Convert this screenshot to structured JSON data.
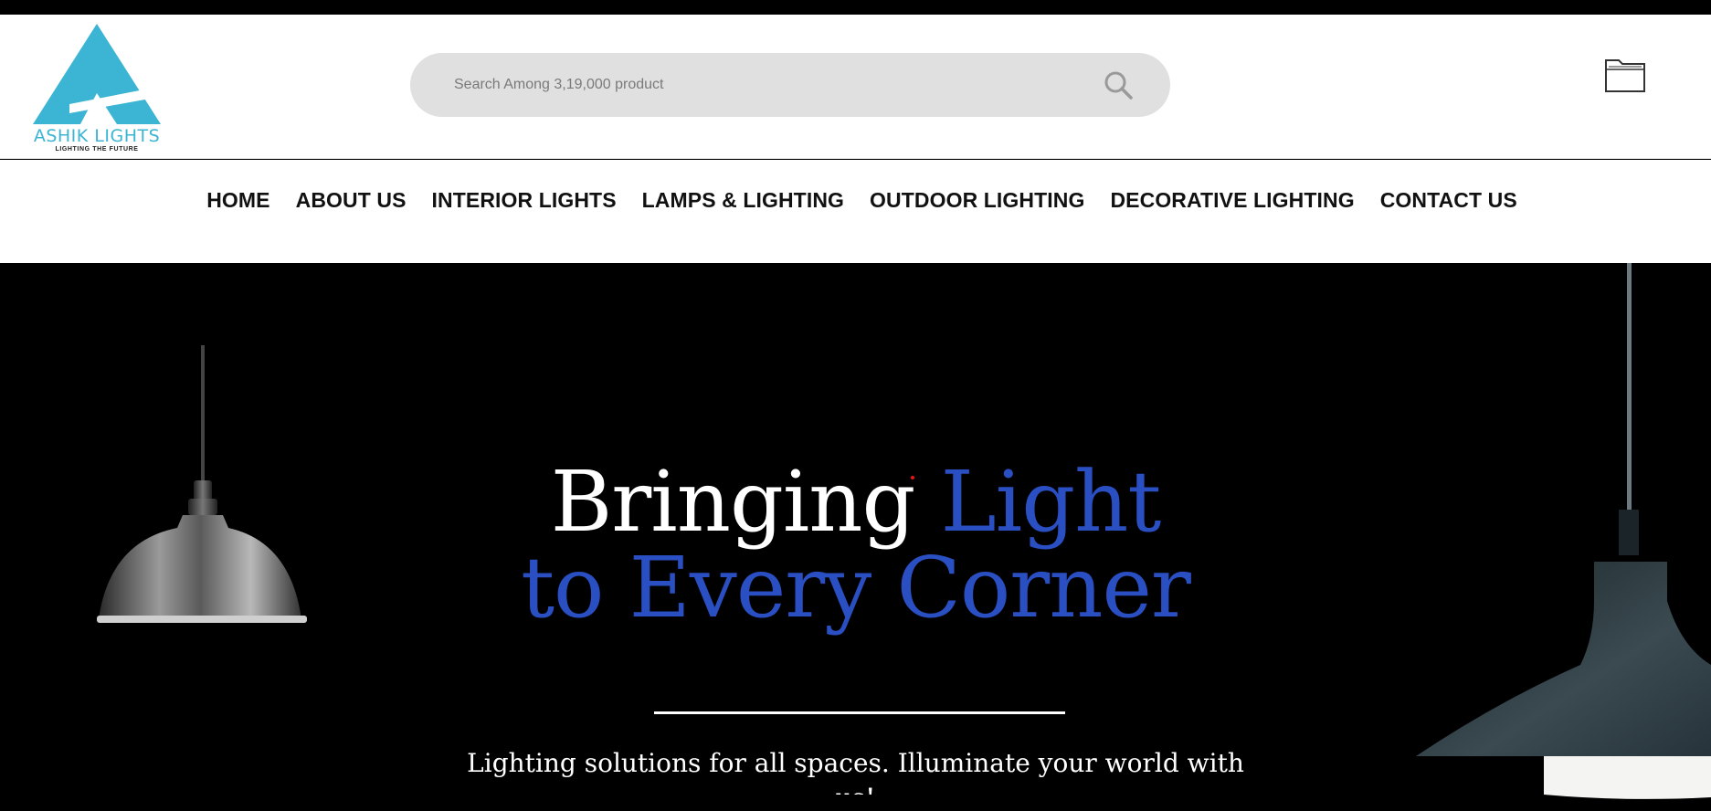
{
  "brand": {
    "name": "ASHIK LIGHTS",
    "tagline": "LIGHTING THE FUTURE",
    "accent_color": "#3cb4d4"
  },
  "search": {
    "placeholder": "Search Among 3,19,000 product",
    "icon": "search-icon"
  },
  "header_actions": {
    "icon": "folder-icon"
  },
  "nav": {
    "items": [
      {
        "label": "HOME"
      },
      {
        "label": "ABOUT US"
      },
      {
        "label": "INTERIOR LIGHTS"
      },
      {
        "label": "LAMPS & LIGHTING"
      },
      {
        "label": "OUTDOOR LIGHTING"
      },
      {
        "label": "DECORATIVE LIGHTING"
      },
      {
        "label": "CONTACT US"
      }
    ]
  },
  "hero": {
    "headline_white": "Bringing",
    "headline_blue_1": "Light",
    "headline_blue_2": "to Every Corner",
    "headline_blue_color": "#2a4fc2",
    "subtitle_line1": "Lighting solutions for all spaces. Illuminate your world with",
    "subtitle_line2_partial": "us!"
  }
}
